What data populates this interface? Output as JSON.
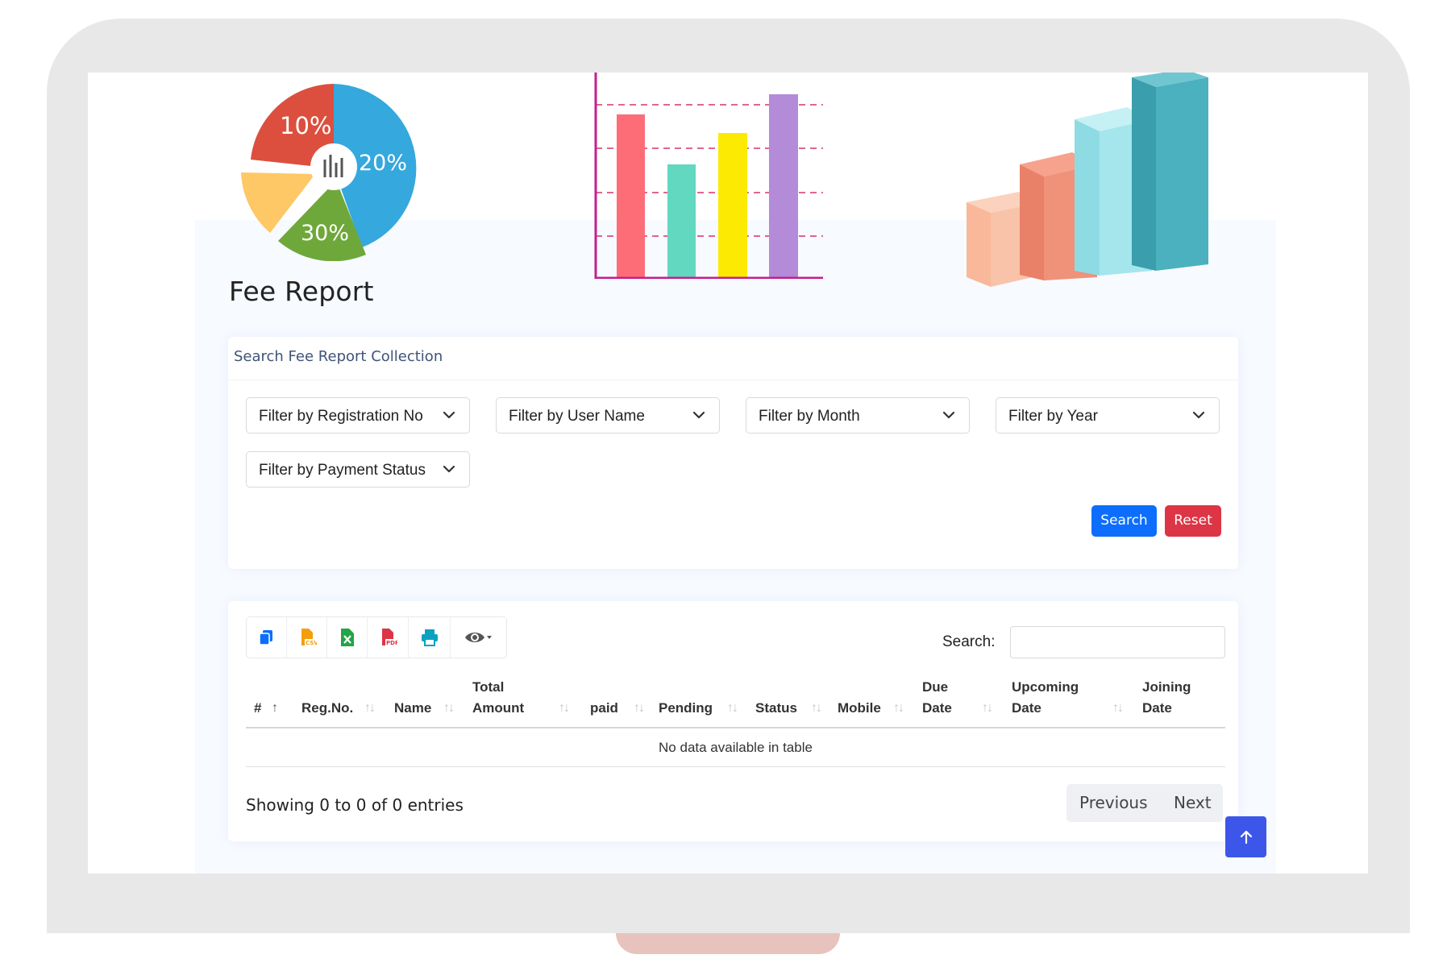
{
  "page": {
    "title": "Fee Report"
  },
  "illustrations": {
    "pie_labels": [
      "10%",
      "20%",
      "30%"
    ]
  },
  "filters": {
    "header": "Search Fee Report Collection",
    "selects": [
      "Filter by Registration No",
      "Filter by User Name",
      "Filter by Month",
      "Filter by Year",
      "Filter by Payment Status"
    ],
    "search_label": "Search",
    "reset_label": "Reset"
  },
  "table": {
    "toolbar": [
      "copy-icon",
      "csv-icon",
      "excel-icon",
      "pdf-icon",
      "print-icon",
      "eye-icon"
    ],
    "search_label": "Search:",
    "search_value": "",
    "columns": [
      {
        "line1": "#",
        "line2": ""
      },
      {
        "line1": "Reg.No.",
        "line2": ""
      },
      {
        "line1": "Name",
        "line2": ""
      },
      {
        "line1": "Total",
        "line2": "Amount"
      },
      {
        "line1": "paid",
        "line2": ""
      },
      {
        "line1": "Pending",
        "line2": ""
      },
      {
        "line1": "Status",
        "line2": ""
      },
      {
        "line1": "Mobile",
        "line2": ""
      },
      {
        "line1": "Due",
        "line2": "Date"
      },
      {
        "line1": "Upcoming",
        "line2": "Date"
      },
      {
        "line1": "Joining",
        "line2": "Date"
      }
    ],
    "empty_text": "No data available in table",
    "info": "Showing 0 to 0 of 0 entries",
    "prev_label": "Previous",
    "next_label": "Next"
  },
  "colors": {
    "primary": "#0d6efd",
    "danger": "#dc3545",
    "scroll_top": "#3d56ea"
  }
}
